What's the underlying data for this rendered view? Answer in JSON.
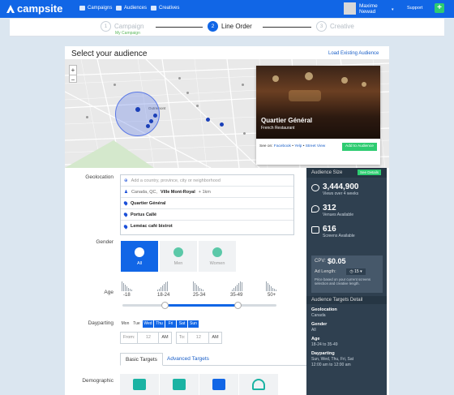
{
  "app": {
    "brand": "campsite",
    "nav": [
      "Campaigns",
      "Audiences",
      "Creatives"
    ],
    "user_name": "Maxime",
    "user_sub": "Newad",
    "support": "Support",
    "plus": "+"
  },
  "steps": [
    {
      "num": "1",
      "label": "Campaign",
      "sub": "My Campaign"
    },
    {
      "num": "2",
      "label": "Line Order"
    },
    {
      "num": "3",
      "label": "Creative"
    }
  ],
  "panel": {
    "title": "Select your audience",
    "load_link": "Load Existing Audience"
  },
  "map": {
    "zoom_in": "+",
    "zoom_out": "−",
    "labels": [
      "Outremont"
    ]
  },
  "place": {
    "name": "Quartier Général",
    "type": "French Restaurant",
    "see_on": "See on:",
    "links": [
      "Facebook",
      "Yelp",
      "Street View"
    ],
    "add_button": "Add to Audience"
  },
  "geolocation": {
    "label": "Geolocation",
    "placeholder": "Add a country, province, city or neighborhood",
    "location_prefix": "Canada, QC,",
    "location_city": "Ville Mont-Royal",
    "location_radius": "+ 1km",
    "places": [
      "Quartier Général",
      "Portus Callé",
      "Leméac café bistrot"
    ]
  },
  "gender": {
    "label": "Gender",
    "options": [
      "All",
      "Men",
      "Women"
    ],
    "selected": "All"
  },
  "age": {
    "label": "Age",
    "ranges": [
      "-18",
      "18-24",
      "25-34",
      "35-49",
      "50+"
    ]
  },
  "dayparting": {
    "label": "Dayparting",
    "days": [
      "Mon",
      "Tue",
      "Wed",
      "Thu",
      "Fri",
      "Sat",
      "Sun"
    ],
    "selected": [
      "Wed",
      "Thu",
      "Fri",
      "Sat",
      "Sun"
    ],
    "from_label": "From:",
    "from_hour": "12",
    "from_ampm": "AM",
    "to_label": "To:",
    "to_hour": "12",
    "to_ampm": "AM"
  },
  "tabs": [
    "Basic Targets",
    "Advanced Targets"
  ],
  "demographic": {
    "label": "Demographic"
  },
  "audience_size": {
    "title": "Audience Size",
    "see_details": "See Details",
    "views": "3,444,900",
    "views_label": "Views over 4 weeks",
    "venues": "312",
    "venues_label": "Venues Available",
    "screens": "616",
    "screens_label": "Screens Available",
    "cpv_label": "CPV:",
    "cpv": "$0.05",
    "ad_length_label": "Ad Length:",
    "ad_length": "15",
    "note": "Price based on your current screens selection and creative length."
  },
  "targets_detail": {
    "title": "Audience Targets Detail",
    "items": [
      {
        "key": "Geolocation",
        "value": "Canada"
      },
      {
        "key": "Gender",
        "value": "All"
      },
      {
        "key": "Age",
        "value": "18-24 to 35-49"
      },
      {
        "key": "Dayparting",
        "value": "Sun, Wed, Thu, Fri, Sat",
        "value2": "12:00 am to 12:00 am"
      }
    ]
  },
  "colors": {
    "primary": "#1166e6",
    "accent_green": "#2ecc71",
    "sidebar": "#2f4050"
  }
}
